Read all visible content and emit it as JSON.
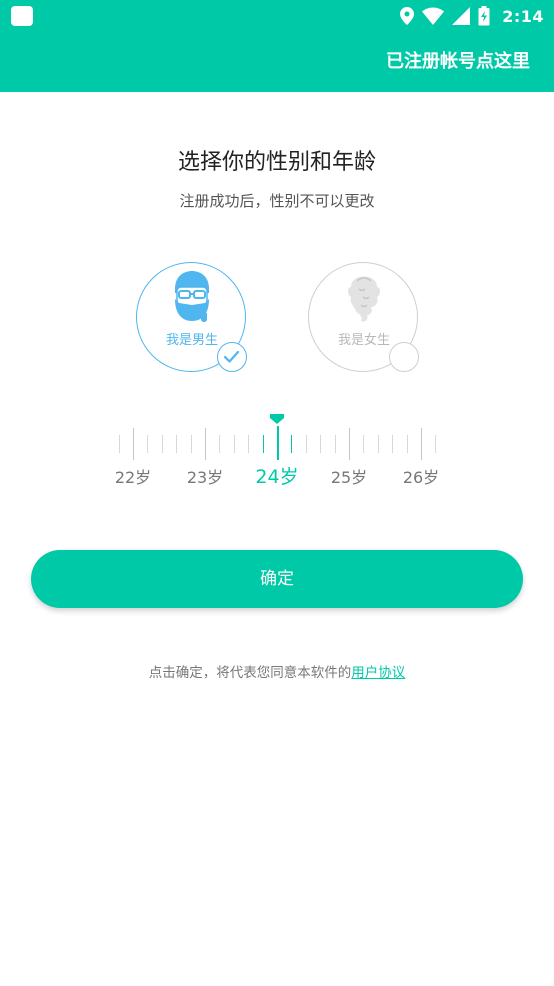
{
  "status_bar": {
    "time": "2:14",
    "icons": [
      "location-icon",
      "wifi-icon",
      "signal-icon",
      "battery-charging-icon"
    ]
  },
  "app_bar": {
    "link_label": "已注册帐号点这里"
  },
  "main": {
    "title": "选择你的性别和年龄",
    "subtitle": "注册成功后，性别不可以更改",
    "genders": [
      {
        "label": "我是男生",
        "selected": true,
        "icon": "male-avatar-icon"
      },
      {
        "label": "我是女生",
        "selected": false,
        "icon": "female-avatar-icon"
      }
    ],
    "age_picker": {
      "labels": [
        "22岁",
        "23岁",
        "24岁",
        "25岁",
        "26岁"
      ],
      "selected": "24岁"
    },
    "confirm_label": "确定",
    "agreement_text": "点击确定，将代表您同意本软件的",
    "agreement_link": "用户协议"
  },
  "colors": {
    "accent": "#00c9a7",
    "male": "#4fb6ef",
    "inactive": "#cfcfcf"
  }
}
